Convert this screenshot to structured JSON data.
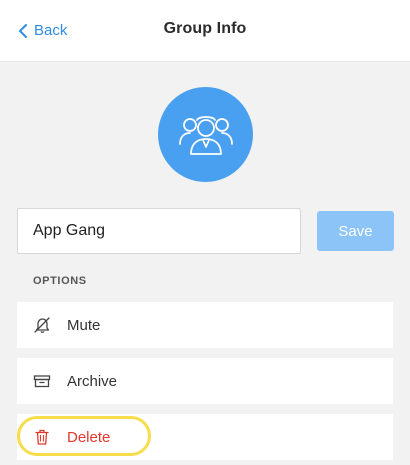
{
  "header": {
    "back_label": "Back",
    "title": "Group Info"
  },
  "avatar": {
    "icon": "group-icon"
  },
  "group": {
    "name_value": "App Gang",
    "save_label": "Save"
  },
  "options": {
    "heading": "OPTIONS",
    "items": [
      {
        "label": "Mute",
        "icon": "bell-off-icon"
      },
      {
        "label": "Archive",
        "icon": "archive-icon"
      },
      {
        "label": "Delete",
        "icon": "trash-icon"
      }
    ]
  },
  "colors": {
    "accent": "#2f8de4",
    "avatar": "#4aa0f0",
    "save_button": "#8cc4f8",
    "danger": "#e0382b",
    "highlight": "#f7dd4a",
    "background": "#f2f2f2"
  }
}
